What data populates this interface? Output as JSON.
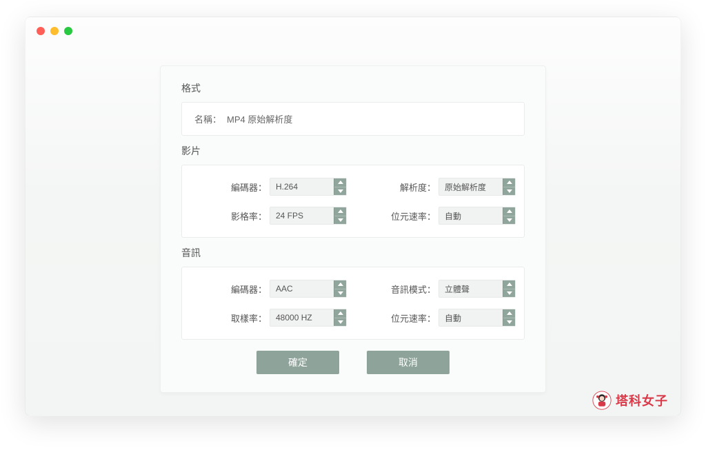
{
  "format": {
    "title": "格式",
    "name_label": "名稱：",
    "name_value": "MP4 原始解析度"
  },
  "video": {
    "title": "影片",
    "encoder_label": "編碼器：",
    "encoder_value": "H.264",
    "resolution_label": "解析度：",
    "resolution_value": "原始解析度",
    "framerate_label": "影格率：",
    "framerate_value": "24 FPS",
    "bitrate_label": "位元速率：",
    "bitrate_value": "自動"
  },
  "audio": {
    "title": "音訊",
    "encoder_label": "編碼器：",
    "encoder_value": "AAC",
    "mode_label": "音訊模式：",
    "mode_value": "立體聲",
    "samplerate_label": "取樣率：",
    "samplerate_value": "48000 HZ",
    "bitrate_label": "位元速率：",
    "bitrate_value": "自動"
  },
  "actions": {
    "ok": "確定",
    "cancel": "取消"
  },
  "watermark": "塔科女子"
}
